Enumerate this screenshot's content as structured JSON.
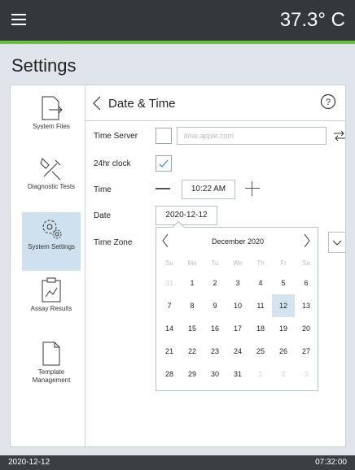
{
  "topbar": {
    "temperature": "37.3° C"
  },
  "page_title": "Settings",
  "sidebar": {
    "items": [
      {
        "label": "System Files",
        "icon": "file-export-icon"
      },
      {
        "label": "Diagnostic Tests",
        "icon": "tools-icon"
      },
      {
        "label": "System Settings",
        "icon": "gears-icon",
        "active": true
      },
      {
        "label": "Assay Results",
        "icon": "chart-clipboard-icon"
      },
      {
        "label": "Template Management",
        "icon": "document-icon"
      }
    ]
  },
  "header": {
    "title": "Date & Time"
  },
  "form": {
    "time_server_label": "Time Server",
    "time_server_placeholder": "time.apple.com",
    "clock_label": "24hr clock",
    "clock_checked": true,
    "time_label": "Time",
    "time_value": "10:22 AM",
    "date_label": "Date",
    "date_value": "2020-12-12",
    "timezone_label": "Time Zone"
  },
  "calendar": {
    "title": "December 2020",
    "weekdays": [
      "Su",
      "Mo",
      "Tu",
      "We",
      "Th",
      "Fr",
      "Sa"
    ],
    "days": [
      {
        "t": "31",
        "m": true
      },
      {
        "t": "1"
      },
      {
        "t": "2"
      },
      {
        "t": "3"
      },
      {
        "t": "4"
      },
      {
        "t": "5"
      },
      {
        "t": "6"
      },
      {
        "t": "7"
      },
      {
        "t": "8"
      },
      {
        "t": "9"
      },
      {
        "t": "10"
      },
      {
        "t": "11"
      },
      {
        "t": "12",
        "sel": true
      },
      {
        "t": "13"
      },
      {
        "t": "14"
      },
      {
        "t": "15"
      },
      {
        "t": "16"
      },
      {
        "t": "17"
      },
      {
        "t": "18"
      },
      {
        "t": "19"
      },
      {
        "t": "20"
      },
      {
        "t": "21"
      },
      {
        "t": "22"
      },
      {
        "t": "23"
      },
      {
        "t": "24"
      },
      {
        "t": "25"
      },
      {
        "t": "26"
      },
      {
        "t": "27"
      },
      {
        "t": "28"
      },
      {
        "t": "29"
      },
      {
        "t": "30"
      },
      {
        "t": "31"
      },
      {
        "t": "1",
        "m": true
      },
      {
        "t": "2",
        "m": true
      },
      {
        "t": "3",
        "m": true
      }
    ]
  },
  "footer": {
    "date": "2020-12-12",
    "time": "07:32:00"
  },
  "colors": {
    "accent": "#6bbf3f",
    "topbar": "#33383d",
    "selected": "#d4e3ef"
  }
}
